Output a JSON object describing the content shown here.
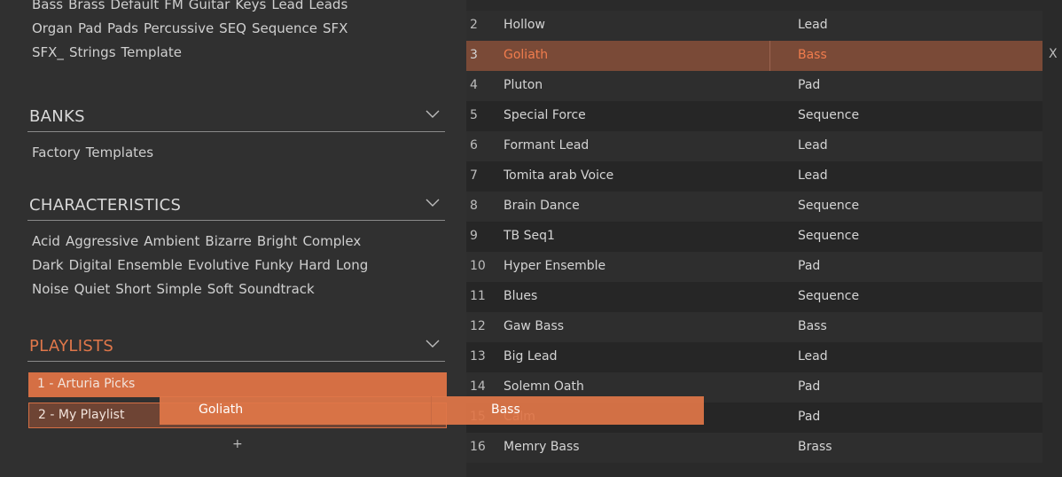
{
  "types": {
    "lines": [
      [
        "Bass",
        "Brass",
        "Default",
        "FM",
        "Guitar",
        "Keys",
        "Lead",
        "Leads"
      ],
      [
        "Organ",
        "Pad",
        "Pads",
        "Percussive",
        "SEQ",
        "Sequence",
        "SFX"
      ],
      [
        "SFX_",
        "Strings",
        "Template"
      ]
    ]
  },
  "banks": {
    "title": "BANKS",
    "items": [
      "Factory",
      "Templates"
    ]
  },
  "characteristics": {
    "title": "CHARACTERISTICS",
    "lines": [
      [
        "Acid",
        "Aggressive",
        "Ambient",
        "Bizarre",
        "Bright",
        "Complex"
      ],
      [
        "Dark",
        "Digital",
        "Ensemble",
        "Evolutive",
        "Funky",
        "Hard",
        "Long"
      ],
      [
        "Noise",
        "Quiet",
        "Short",
        "Simple",
        "Soft",
        "Soundtrack"
      ]
    ]
  },
  "playlists": {
    "title": "PLAYLISTS",
    "items": [
      "1 - Arturia Picks",
      "2 - My Playlist"
    ],
    "add_label": "+"
  },
  "presets": [
    {
      "num": "2",
      "name": "Hollow",
      "type": "Lead"
    },
    {
      "num": "3",
      "name": "Goliath",
      "type": "Bass",
      "selected": true
    },
    {
      "num": "4",
      "name": "Pluton",
      "type": "Pad"
    },
    {
      "num": "5",
      "name": "Special Force",
      "type": "Sequence"
    },
    {
      "num": "6",
      "name": "Formant Lead",
      "type": "Lead"
    },
    {
      "num": "7",
      "name": "Tomita arab Voice",
      "type": "Lead"
    },
    {
      "num": "8",
      "name": "Brain Dance",
      "type": "Sequence"
    },
    {
      "num": "9",
      "name": "TB Seq1",
      "type": "Sequence"
    },
    {
      "num": "10",
      "name": "Hyper Ensemble",
      "type": "Pad"
    },
    {
      "num": "11",
      "name": "Blues",
      "type": "Sequence"
    },
    {
      "num": "12",
      "name": "Gaw Bass",
      "type": "Bass"
    },
    {
      "num": "13",
      "name": "Big Lead",
      "type": "Lead"
    },
    {
      "num": "14",
      "name": "Solemn Oath",
      "type": "Pad"
    },
    {
      "num": "15",
      "name": "Calm",
      "type": "Pad"
    },
    {
      "num": "16",
      "name": "Memry Bass",
      "type": "Brass"
    }
  ],
  "remove_label": "X",
  "drag_ghost": {
    "name": "Goliath",
    "type": "Bass"
  },
  "colors": {
    "accent": "#e07648",
    "selected_row": "#7a4a37",
    "panel": "#303030",
    "list_bg": "#262626"
  }
}
